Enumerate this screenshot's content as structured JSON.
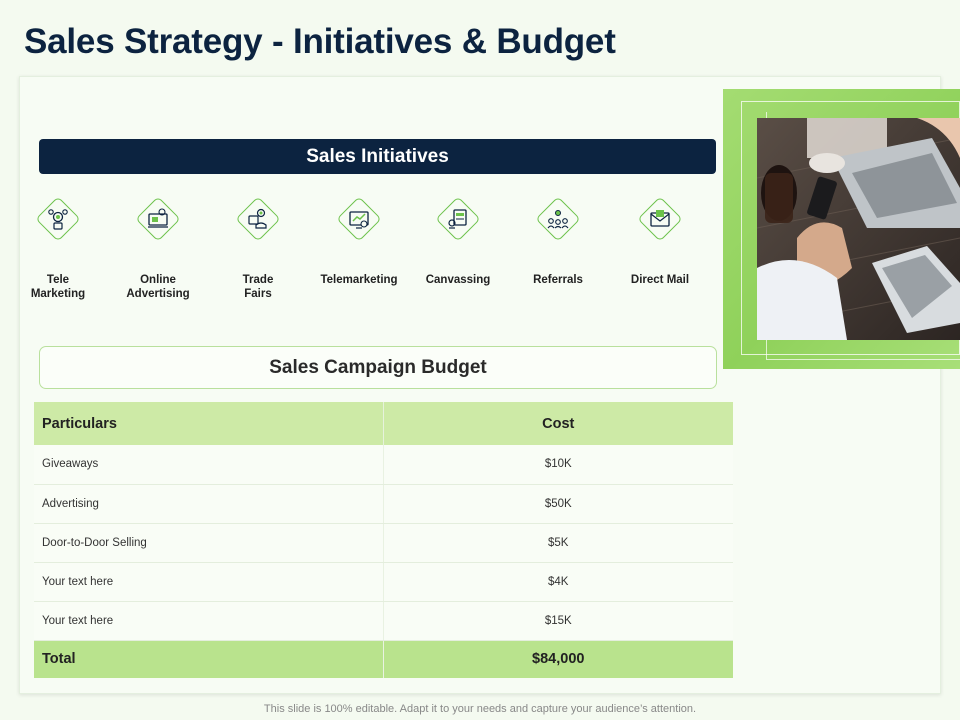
{
  "title": "Sales Strategy - Initiatives & Budget",
  "initiatives": {
    "header": "Sales Initiatives",
    "items": [
      {
        "label": "Tele\nMarketing",
        "icon": "tele-marketing-icon"
      },
      {
        "label": "Online\nAdvertising",
        "icon": "online-advertising-icon"
      },
      {
        "label": "Trade\nFairs",
        "icon": "trade-fairs-icon"
      },
      {
        "label": "Telemarketing",
        "icon": "telemarketing-icon"
      },
      {
        "label": "Canvassing",
        "icon": "canvassing-icon"
      },
      {
        "label": "Referrals",
        "icon": "referrals-icon"
      },
      {
        "label": "Direct Mail",
        "icon": "direct-mail-icon"
      }
    ]
  },
  "budget": {
    "header": "Sales Campaign Budget",
    "columns": [
      "Particulars",
      "Cost"
    ],
    "rows": [
      [
        "Giveaways",
        "$10K"
      ],
      [
        "Advertising",
        "$50K"
      ],
      [
        "Door-to-Door Selling",
        "$5K"
      ],
      [
        "Your text here",
        "$4K"
      ],
      [
        "Your text here",
        "$15K"
      ]
    ],
    "total": [
      "Total",
      "$84,000"
    ]
  },
  "footer": "This slide is 100% editable. Adapt it to your needs and capture your audience’s attention.",
  "colors": {
    "navy": "#0c2340",
    "accent_green": "#6cc24a",
    "header_green": "#cdeaa6",
    "total_green": "#b9e38d"
  }
}
